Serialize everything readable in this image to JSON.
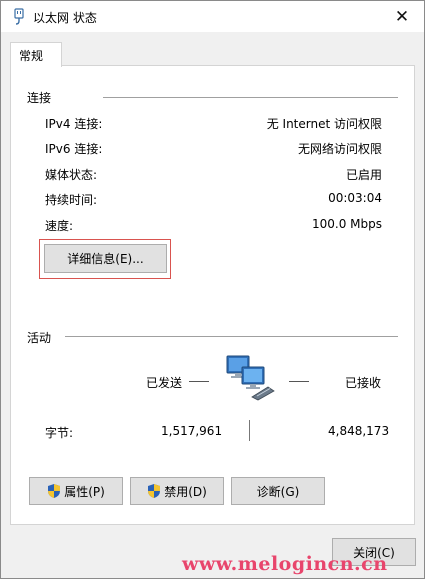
{
  "window": {
    "title": "以太网 状态"
  },
  "tabs": [
    {
      "label": "常规"
    }
  ],
  "connection": {
    "group_label": "连接",
    "rows": [
      {
        "label": "IPv4 连接:",
        "value": "无 Internet 访问权限"
      },
      {
        "label": "IPv6 连接:",
        "value": "无网络访问权限"
      },
      {
        "label": "媒体状态:",
        "value": "已启用"
      },
      {
        "label": "持续时间:",
        "value": "00:03:04"
      },
      {
        "label": "速度:",
        "value": "100.0 Mbps"
      }
    ],
    "details_button": "详细信息(E)..."
  },
  "activity": {
    "group_label": "活动",
    "sent_label": "已发送",
    "received_label": "已接收",
    "bytes_label": "字节:",
    "bytes_sent": "1,517,961",
    "bytes_received": "4,848,173"
  },
  "buttons": {
    "properties": "属性(P)",
    "disable": "禁用(D)",
    "diagnose": "诊断(G)",
    "close": "关闭(C)"
  },
  "watermark": "www.melogincn.cn",
  "icons": {
    "title": "ethernet-plug-icon",
    "network": "network-computers-icon",
    "shield": "uac-shield-icon",
    "close": "close-icon"
  },
  "colors": {
    "highlight_border": "#d9534f",
    "watermark": "#e8456c"
  }
}
